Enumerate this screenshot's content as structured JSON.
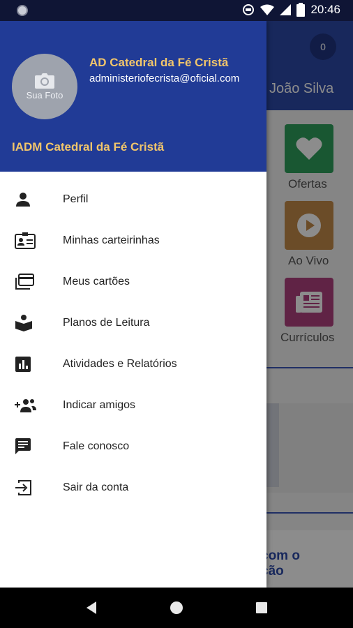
{
  "status_bar": {
    "time": "20:46",
    "icons": [
      "notification-dot-icon",
      "data-saver-icon",
      "wifi-icon",
      "signal-icon",
      "battery-icon"
    ]
  },
  "background_app": {
    "badge_count": "0",
    "user_name": "João Silva",
    "tiles": [
      {
        "label": "Ofertas",
        "icon": "heart-icon",
        "color": "#2e9e5b"
      },
      {
        "label": "Ao Vivo",
        "icon": "play-icon",
        "color": "#c48a4a"
      },
      {
        "label": "Currículos",
        "icon": "newspaper-icon",
        "color": "#b0407e"
      }
    ],
    "promo_text_line1": "com o",
    "promo_text_line2": "ção"
  },
  "drawer": {
    "avatar_caption": "Sua Foto",
    "org_name": "AD Catedral da Fé Cristã",
    "org_email": "administeriofecrista@oficial.com",
    "church_name": "IADM Catedral da Fé Cristã",
    "menu": [
      {
        "label": "Perfil",
        "icon": "person-icon"
      },
      {
        "label": "Minhas carteirinhas",
        "icon": "id-card-icon"
      },
      {
        "label": "Meus cartões",
        "icon": "cards-icon"
      },
      {
        "label": "Planos de Leitura",
        "icon": "book-reader-icon"
      },
      {
        "label": "Atividades e Relatórios",
        "icon": "bar-chart-icon"
      },
      {
        "label": "Indicar amigos",
        "icon": "add-group-icon"
      },
      {
        "label": "Fale conosco",
        "icon": "chat-icon"
      },
      {
        "label": "Sair da conta",
        "icon": "logout-icon"
      }
    ]
  },
  "colors": {
    "header_blue": "#213b96",
    "gold_text": "#f2c66b",
    "app_blue": "#2d4aa8"
  },
  "nav_bar": {
    "icons": [
      "back-icon",
      "home-icon",
      "recents-icon"
    ]
  }
}
